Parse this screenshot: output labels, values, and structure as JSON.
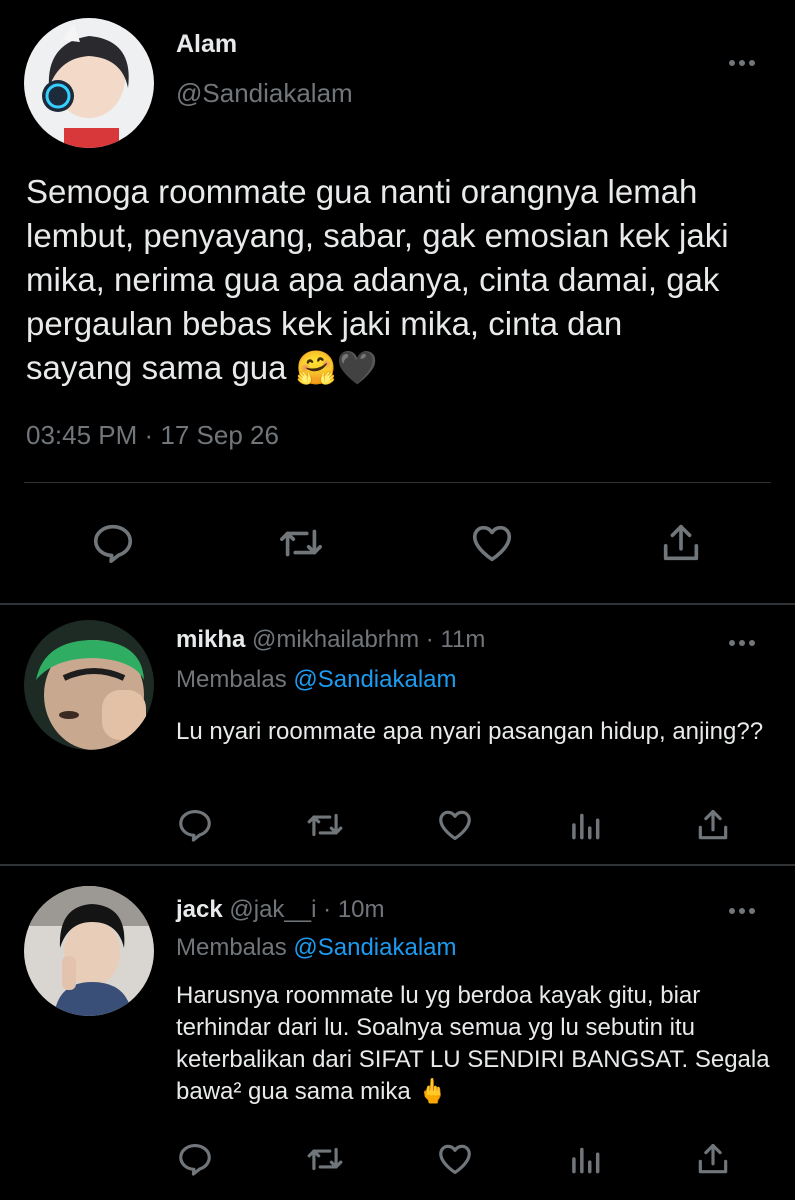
{
  "main_tweet": {
    "author_name": "Alam",
    "author_handle": "@Sandiakalam",
    "text": "Semoga roommate gua nanti orangnya lemah\nlembut, penyayang, sabar, gak emosian kek jaki\nmika, nerima gua apa adanya, cinta damai, gak\npergaulan bebas kek jaki mika, cinta dan\nsayang sama gua 🤗🖤",
    "timestamp": "03:45 PM · 17 Sep 26",
    "actions": [
      "reply-icon",
      "retweet-icon",
      "like-icon",
      "share-icon"
    ]
  },
  "replies": [
    {
      "name": "mikha",
      "handle": "@mikhailabrhm",
      "separator": "·",
      "time": "11m",
      "replying_prefix": "Membalas ",
      "replying_to": "@Sandiakalam",
      "text": "Lu nyari roommate apa nyari pasangan hidup, anjing??"
    },
    {
      "name": "jack",
      "handle": "@jak__i",
      "separator": "·",
      "time": "10m",
      "replying_prefix": "Membalas ",
      "replying_to": "@Sandiakalam",
      "text": "Harusnya roommate lu yg berdoa kayak gitu, biar terhindar dari lu. Soalnya semua yg lu sebutin itu keterbalikan dari SIFAT LU SENDIRI BANGSAT. Segala bawa² gua sama mika 🖕"
    }
  ],
  "colors": {
    "background": "#000000",
    "text": "#e7e9ea",
    "secondary": "#71767b",
    "link": "#1d9bf0",
    "divider": "#2f3336"
  }
}
